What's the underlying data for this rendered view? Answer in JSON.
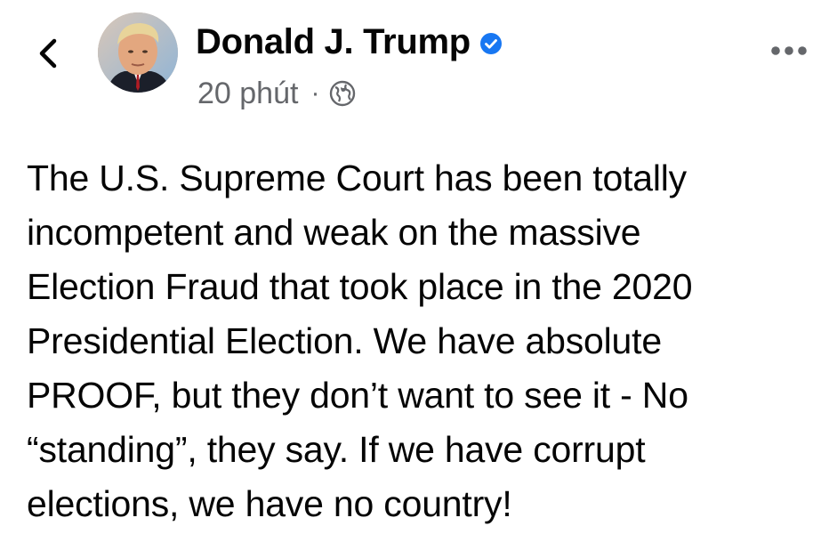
{
  "header": {
    "back_icon": "chevron-left-icon",
    "author_name": "Donald J. Trump",
    "verified_icon": "verified-badge-icon",
    "verified_color": "#1877f2",
    "timestamp": "20 phút",
    "separator": "·",
    "privacy_icon": "globe-icon",
    "more_icon": "more-horizontal-icon"
  },
  "post": {
    "text": "The U.S. Supreme Court has been totally\nincompetent and weak on the massive\nElection Fraud that took place in the 2020\nPresidential Election. We have absolute\nPROOF, but they don’t want to see it - No\n“standing”, they say. If we have corrupt\nelections, we have no country!"
  }
}
